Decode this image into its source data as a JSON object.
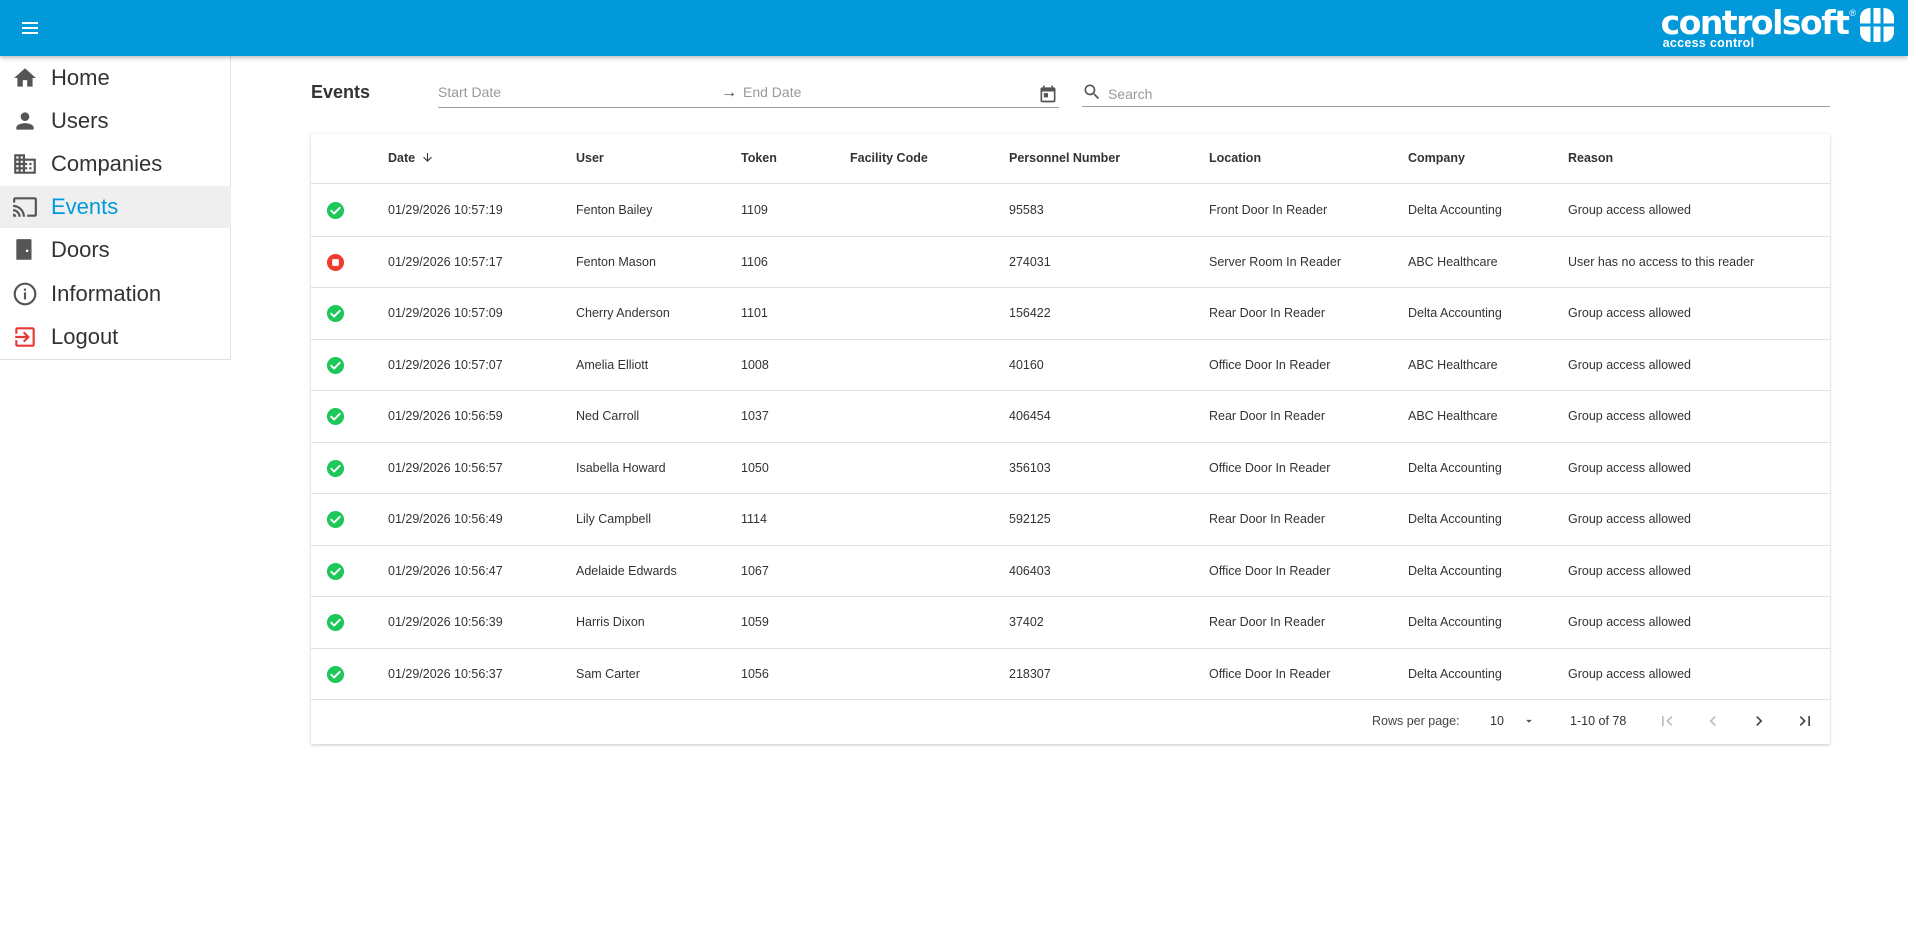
{
  "app": {
    "brand": "controlsoft",
    "brand_sub": "access control",
    "brand_reg": "®"
  },
  "sidebar": {
    "items": [
      {
        "label": "Home",
        "icon": "home-icon"
      },
      {
        "label": "Users",
        "icon": "person-icon"
      },
      {
        "label": "Companies",
        "icon": "building-icon"
      },
      {
        "label": "Events",
        "icon": "cast-icon",
        "active": true
      },
      {
        "label": "Doors",
        "icon": "door-icon"
      },
      {
        "label": "Information",
        "icon": "info-icon"
      },
      {
        "label": "Logout",
        "icon": "logout-icon"
      }
    ]
  },
  "main": {
    "title": "Events",
    "start_date_placeholder": "Start Date",
    "end_date_placeholder": "End Date",
    "date_arrow": "→",
    "search_placeholder": "Search"
  },
  "table": {
    "columns": [
      "Date",
      "User",
      "Token",
      "Facility Code",
      "Personnel Number",
      "Location",
      "Company",
      "Reason"
    ],
    "rows": [
      {
        "status": "allowed",
        "date": "01/29/2026 10:57:19",
        "user": "Fenton Bailey",
        "token": "1109",
        "facility": "",
        "personnel": "95583",
        "location": "Front Door In Reader",
        "company": "Delta Accounting",
        "reason": "Group access allowed"
      },
      {
        "status": "denied",
        "date": "01/29/2026 10:57:17",
        "user": "Fenton Mason",
        "token": "1106",
        "facility": "",
        "personnel": "274031",
        "location": "Server Room In Reader",
        "company": "ABC Healthcare",
        "reason": "User has no access to this reader"
      },
      {
        "status": "allowed",
        "date": "01/29/2026 10:57:09",
        "user": "Cherry Anderson",
        "token": "1101",
        "facility": "",
        "personnel": "156422",
        "location": "Rear Door In Reader",
        "company": "Delta Accounting",
        "reason": "Group access allowed"
      },
      {
        "status": "allowed",
        "date": "01/29/2026 10:57:07",
        "user": "Amelia Elliott",
        "token": "1008",
        "facility": "",
        "personnel": "40160",
        "location": "Office Door In Reader",
        "company": "ABC Healthcare",
        "reason": "Group access allowed"
      },
      {
        "status": "allowed",
        "date": "01/29/2026 10:56:59",
        "user": "Ned Carroll",
        "token": "1037",
        "facility": "",
        "personnel": "406454",
        "location": "Rear Door In Reader",
        "company": "ABC Healthcare",
        "reason": "Group access allowed"
      },
      {
        "status": "allowed",
        "date": "01/29/2026 10:56:57",
        "user": "Isabella Howard",
        "token": "1050",
        "facility": "",
        "personnel": "356103",
        "location": "Office Door In Reader",
        "company": "Delta Accounting",
        "reason": "Group access allowed"
      },
      {
        "status": "allowed",
        "date": "01/29/2026 10:56:49",
        "user": "Lily Campbell",
        "token": "1114",
        "facility": "",
        "personnel": "592125",
        "location": "Rear Door In Reader",
        "company": "Delta Accounting",
        "reason": "Group access allowed"
      },
      {
        "status": "allowed",
        "date": "01/29/2026 10:56:47",
        "user": "Adelaide Edwards",
        "token": "1067",
        "facility": "",
        "personnel": "406403",
        "location": "Office Door In Reader",
        "company": "Delta Accounting",
        "reason": "Group access allowed"
      },
      {
        "status": "allowed",
        "date": "01/29/2026 10:56:39",
        "user": "Harris Dixon",
        "token": "1059",
        "facility": "",
        "personnel": "37402",
        "location": "Rear Door In Reader",
        "company": "Delta Accounting",
        "reason": "Group access allowed"
      },
      {
        "status": "allowed",
        "date": "01/29/2026 10:56:37",
        "user": "Sam Carter",
        "token": "1056",
        "facility": "",
        "personnel": "218307",
        "location": "Office Door In Reader",
        "company": "Delta Accounting",
        "reason": "Group access allowed"
      }
    ]
  },
  "pagination": {
    "rows_per_page_label": "Rows per page:",
    "rows_per_page": "10",
    "range": "1-10 of 78"
  },
  "colors": {
    "brand": "#0299db",
    "allowed": "#1ec75a",
    "denied": "#f03c30",
    "logout": "#e53935"
  }
}
